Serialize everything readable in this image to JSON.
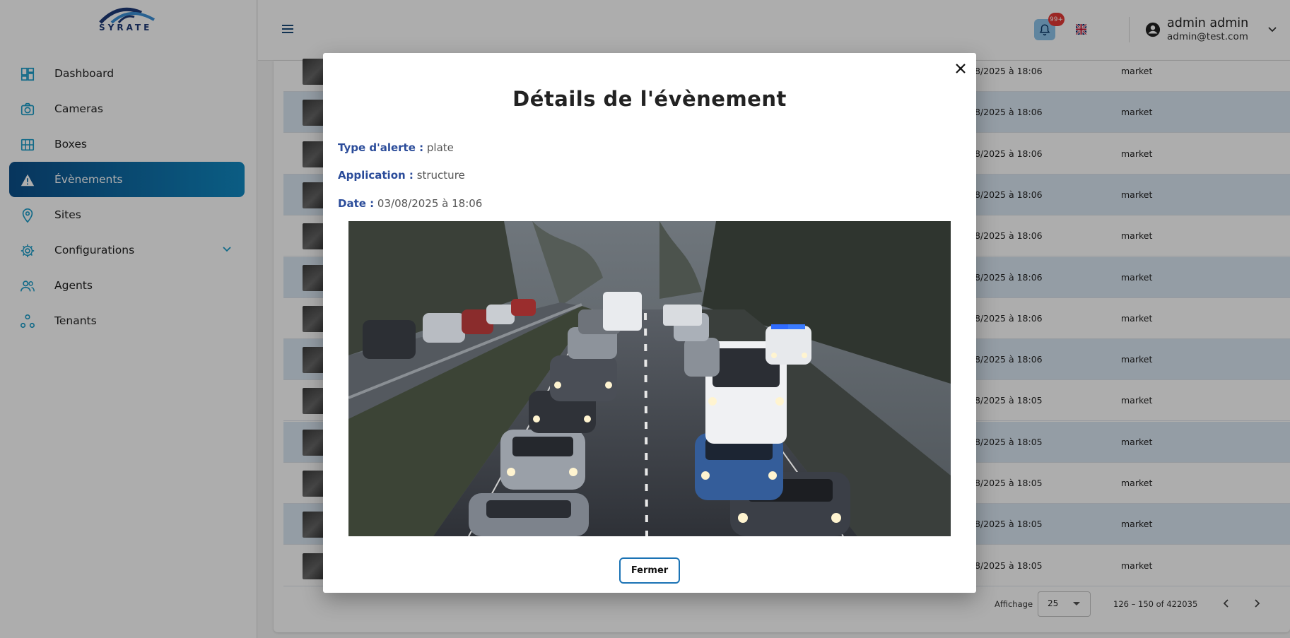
{
  "brand": {
    "logo_text": "SYRATE"
  },
  "sidebar": {
    "items": [
      {
        "label": "Dashboard",
        "icon": "dashboard-icon"
      },
      {
        "label": "Cameras",
        "icon": "camera-icon"
      },
      {
        "label": "Boxes",
        "icon": "boxes-icon"
      },
      {
        "label": "Évènements",
        "icon": "warning-icon",
        "active": true
      },
      {
        "label": "Sites",
        "icon": "location-pin-icon"
      },
      {
        "label": "Configurations",
        "icon": "gear-icon",
        "has_submenu": true
      },
      {
        "label": "Agents",
        "icon": "people-icon"
      },
      {
        "label": "Tenants",
        "icon": "network-icon"
      }
    ]
  },
  "header": {
    "notifications_badge": "99+",
    "language_flag": "uk-flag-icon",
    "user": {
      "name": "admin admin",
      "email": "admin@test.com"
    }
  },
  "table": {
    "rows": [
      {
        "date": "8/2025 à 18:06",
        "app": "market"
      },
      {
        "date": "8/2025 à 18:06",
        "app": "market"
      },
      {
        "date": "8/2025 à 18:06",
        "app": "market"
      },
      {
        "date": "8/2025 à 18:06",
        "app": "market"
      },
      {
        "date": "8/2025 à 18:06",
        "app": "market"
      },
      {
        "date": "8/2025 à 18:06",
        "app": "market"
      },
      {
        "date": "8/2025 à 18:06",
        "app": "market"
      },
      {
        "date": "8/2025 à 18:06",
        "app": "market"
      },
      {
        "date": "8/2025 à 18:05",
        "app": "market"
      },
      {
        "date": "8/2025 à 18:05",
        "app": "market"
      },
      {
        "date": "8/2025 à 18:05",
        "app": "market"
      },
      {
        "date": "8/2025 à 18:05",
        "app": "market"
      },
      {
        "date": "8/2025 à 18:05",
        "app": "market"
      }
    ]
  },
  "pagination": {
    "label": "Affichage",
    "page_size": "25",
    "range": "126 – 150 of 422035"
  },
  "modal": {
    "title": "Détails de l'évènement",
    "type_label": "Type d'alerte :",
    "type_value": "plate",
    "app_label": "Application :",
    "app_value": "structure",
    "date_label": "Date :",
    "date_value": "03/08/2025 à 18:06",
    "close_label": "Fermer"
  },
  "colors": {
    "accent": "#1189c2",
    "label_blue": "#2b4c9a",
    "row_alt": "#dbe7f4",
    "badge": "#e53935"
  }
}
